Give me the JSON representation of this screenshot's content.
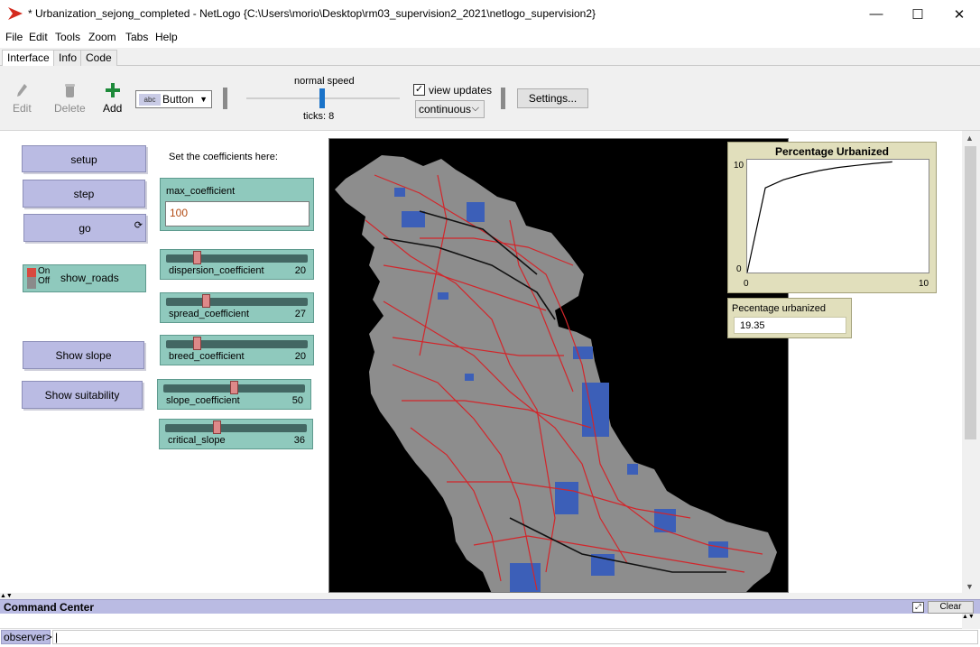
{
  "window": {
    "title": "* Urbanization_sejong_completed - NetLogo {C:\\Users\\morio\\Desktop\\rm03_supervision2_2021\\netlogo_supervision2}",
    "minimize": "—",
    "maximize": "☐",
    "close": "✕"
  },
  "menu": {
    "file": "File",
    "edit": "Edit",
    "tools": "Tools",
    "zoom": "Zoom",
    "tabs": "Tabs",
    "help": "Help"
  },
  "tabs": {
    "interface": "Interface",
    "info": "Info",
    "code": "Code"
  },
  "toolbar": {
    "edit": "Edit",
    "delete": "Delete",
    "add": "Add",
    "widget_type": "Button",
    "widget_type_badge": "abc",
    "speed_label": "normal speed",
    "speed_value": 0.5,
    "ticks": "ticks: 8",
    "view_updates_label": "view updates",
    "view_updates_checked": true,
    "update_mode": "continuous",
    "settings": "Settings..."
  },
  "widgets": {
    "setup": "setup",
    "step": "step",
    "go": "go",
    "go_forever_icon": "forever-icon",
    "show_roads": {
      "on": "On",
      "off": "Off",
      "label": "show_roads"
    },
    "show_slope": "Show slope",
    "show_suitability": "Show suitability",
    "note": "Set the coefficients here:",
    "max_coefficient": {
      "label": "max_coefficient",
      "value": "100"
    },
    "sliders": [
      {
        "name": "dispersion_coefficient",
        "value": "20",
        "fraction": 0.2
      },
      {
        "name": "spread_coefficient",
        "value": "27",
        "fraction": 0.27
      },
      {
        "name": "breed_coefficient",
        "value": "20",
        "fraction": 0.2
      },
      {
        "name": "slope_coefficient",
        "value": "50",
        "fraction": 0.5
      },
      {
        "name": "critical_slope",
        "value": "36",
        "fraction": 0.36
      }
    ]
  },
  "plot": {
    "title": "Percentage Urbanized",
    "y_max_label": "10",
    "y_min_label": "0",
    "x_min_label": "0",
    "x_max_label": "10"
  },
  "monitor": {
    "label": "Pecentage urbanized",
    "value": "19.35"
  },
  "command_center": {
    "title": "Command Center",
    "clear": "Clear",
    "agent": "observer>"
  },
  "colors": {
    "button_bg": "#babbe3",
    "input_widget_bg": "#8fc9bd",
    "plot_bg": "#e1dfbc",
    "terrain": "#8d8d8d",
    "roads": "#d2262b",
    "urban": "#3c5fb8",
    "add_icon": "#1d8a3a"
  },
  "chart_data": {
    "type": "line",
    "title": "Percentage Urbanized",
    "xlabel": "",
    "ylabel": "",
    "xlim": [
      0,
      10
    ],
    "ylim": [
      0,
      10
    ],
    "series": [
      {
        "values": [
          [
            0,
            0
          ],
          [
            1,
            8.3
          ],
          [
            2,
            9.1
          ],
          [
            3,
            9.6
          ],
          [
            4,
            10.0
          ],
          [
            5,
            10.3
          ],
          [
            6,
            10.5
          ],
          [
            7,
            10.7
          ],
          [
            8,
            10.85
          ]
        ]
      }
    ]
  }
}
